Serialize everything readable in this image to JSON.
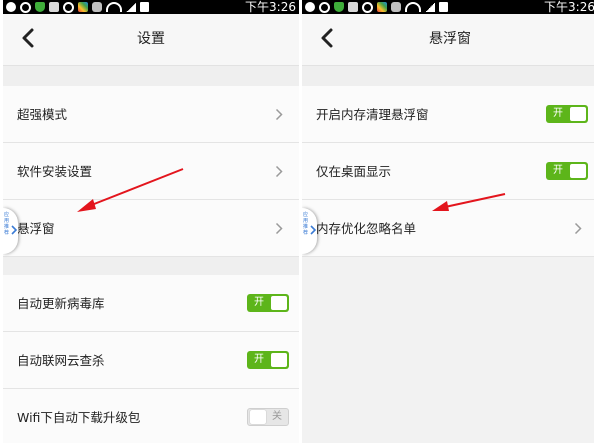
{
  "status_bar": {
    "time": "下午3:26",
    "icons": [
      "add-circle-icon",
      "navigation-icon",
      "shield-icon",
      "image-icon",
      "message-icon",
      "color-app-icon",
      "wifi-icon",
      "signal-icon",
      "battery-icon"
    ]
  },
  "left_screen": {
    "title": "设置",
    "rows": [
      {
        "label": "超强模式"
      },
      {
        "label": "软件安装设置"
      },
      {
        "label": "悬浮窗"
      },
      {
        "label": "自动更新病毒库",
        "toggle": "开",
        "state": "on"
      },
      {
        "label": "自动联网云查杀",
        "toggle": "开",
        "state": "on"
      },
      {
        "label": "Wifi下自动下载升级包",
        "toggle": "关",
        "state": "off"
      }
    ],
    "float_ball_text": "应用推荐"
  },
  "right_screen": {
    "title": "悬浮窗",
    "rows": [
      {
        "label": "开启内存清理悬浮窗",
        "toggle": "开",
        "state": "on"
      },
      {
        "label": "仅在桌面显示",
        "toggle": "开",
        "state": "on"
      },
      {
        "label": "内存优化忽略名单"
      }
    ],
    "float_ball_text": "应用推荐"
  },
  "colors": {
    "toggle_on": "#5db51a",
    "arrow_red": "#e3151d",
    "float_text": "#3a7bd5"
  }
}
